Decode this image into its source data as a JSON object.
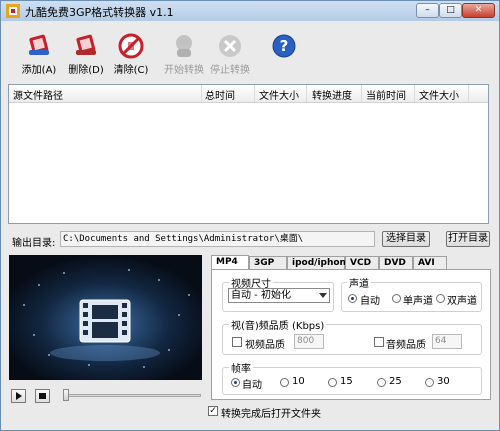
{
  "window": {
    "title": "九酷免费3GP格式转换器 v1.1",
    "controls": {
      "minimize": "–",
      "maximize": "□",
      "close": "✕"
    }
  },
  "toolbar": {
    "buttons": [
      {
        "label": "添加(A)",
        "icon": "add-film-icon",
        "enabled": true
      },
      {
        "label": "删除(D)",
        "icon": "delete-film-icon",
        "enabled": true
      },
      {
        "label": "清除(C)",
        "icon": "clear-icon",
        "enabled": true
      },
      {
        "label": "开始转换",
        "icon": "start-convert-icon",
        "enabled": false
      },
      {
        "label": "停止转换",
        "icon": "stop-convert-icon",
        "enabled": false
      },
      {
        "label": "",
        "icon": "help-icon",
        "enabled": true
      }
    ]
  },
  "file_list": {
    "columns": [
      "源文件路径",
      "总时间",
      "文件大小",
      "转换进度",
      "当前时间",
      "文件大小"
    ],
    "rows": []
  },
  "output": {
    "label": "输出目录:",
    "path": "C:\\Documents and Settings\\Administrator\\桌面\\",
    "choose_button": "选择目录",
    "open_button": "打开目录"
  },
  "player": {
    "play_icon": "play-icon",
    "stop_icon": "stop-icon",
    "position": 0
  },
  "tabs": [
    "MP4",
    "3GP",
    "ipod/iphone",
    "VCD",
    "DVD",
    "AVI"
  ],
  "active_tab": "MP4",
  "settings": {
    "video_size_label": "视频尺寸",
    "video_size_value": "自动 - 初始化",
    "audio_channel_label": "声道",
    "channels": [
      "自动",
      "单声道",
      "双声道"
    ],
    "channel_selected": "自动",
    "quality_label": "视(音)频品质 (Kbps)",
    "video_quality_label": "视频品质",
    "video_quality_value": "800",
    "audio_quality_label": "音频品质",
    "audio_quality_value": "64",
    "framerate_label": "帧率",
    "framerates": [
      "自动",
      "10",
      "15",
      "25",
      "30"
    ],
    "framerate_selected": "自动",
    "open_folder_after": "转换完成后打开文件夹",
    "open_folder_checked": true
  },
  "colors": {
    "accent_red": "#c8202a",
    "help_blue": "#2a60c2",
    "title_gradient": "#b4cbe5"
  }
}
